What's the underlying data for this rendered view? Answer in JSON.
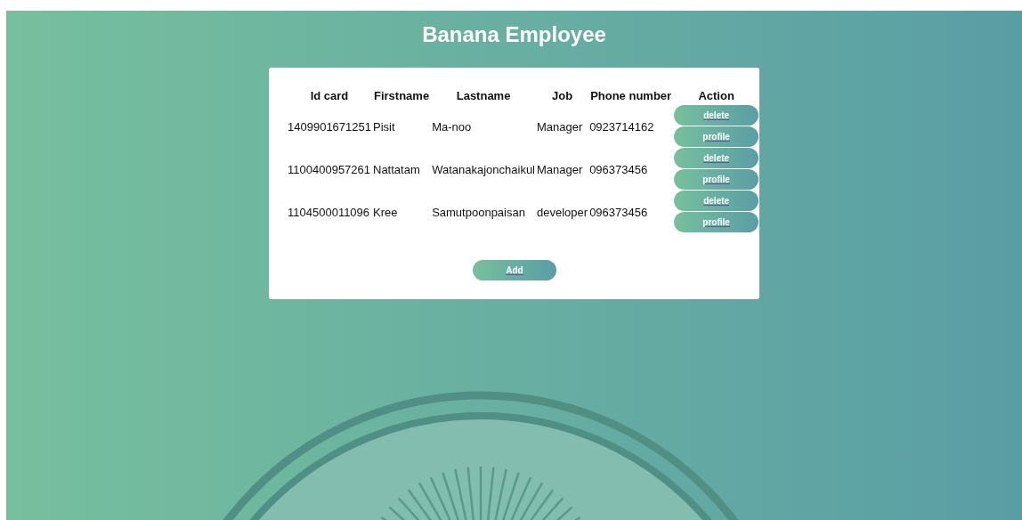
{
  "title": "Banana Employee",
  "table": {
    "columns": [
      "Id card",
      "Firstname",
      "Lastname",
      "Job",
      "Phone number",
      "Action"
    ],
    "rows": [
      {
        "id_card": "1409901671251",
        "firstname": "Pisit",
        "lastname": "Ma-noo",
        "job": "Manager",
        "phone": "0923714162",
        "actions": [
          "delete",
          "profile"
        ]
      },
      {
        "id_card": "1100400957261",
        "firstname": "Nattatam",
        "lastname": "Watanakajonchaikul",
        "job": "Manager",
        "phone": "096373456",
        "actions": [
          "delete",
          "profile"
        ]
      },
      {
        "id_card": "1104500011096",
        "firstname": "Kree",
        "lastname": "Samutpoonpaisan",
        "job": "developer",
        "phone": "096373456",
        "actions": [
          "delete",
          "profile"
        ]
      }
    ]
  },
  "add_button": "Add"
}
